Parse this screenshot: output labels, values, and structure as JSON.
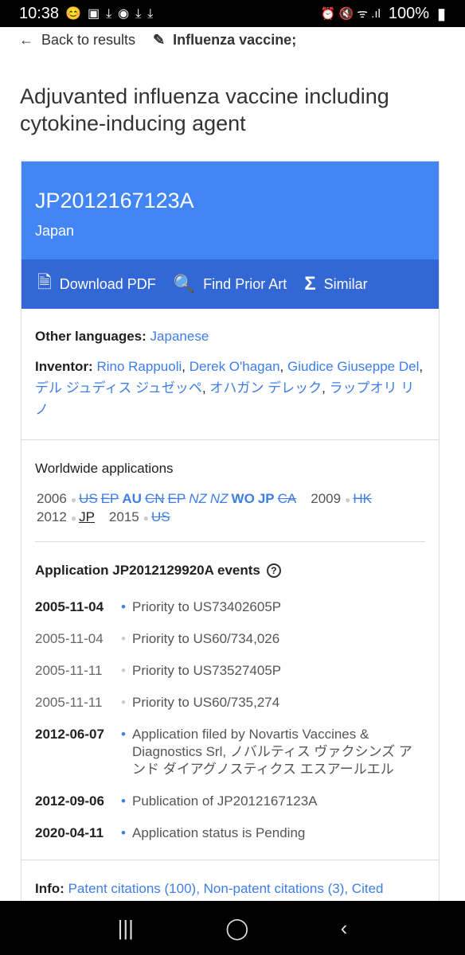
{
  "status": {
    "time": "10:38",
    "battery": "100%"
  },
  "nav": {
    "back": "Back to results",
    "query": "Influenza vaccine;"
  },
  "title": "Adjuvanted influenza vaccine including cytokine-inducing agent",
  "patent": {
    "id": "JP2012167123A",
    "country": "Japan"
  },
  "actions": {
    "download": "Download PDF",
    "prior_art": "Find Prior Art",
    "similar": "Similar"
  },
  "other_languages": {
    "label": "Other languages:",
    "value": "Japanese"
  },
  "inventor": {
    "label": "Inventor:",
    "names": [
      "Rino Rappuoli",
      "Derek O'hagan",
      "Giudice Giuseppe Del",
      "デル ジュディス ジュゼッペ",
      "オハガン デレック",
      "ラップオリ リノ"
    ]
  },
  "worldwide": {
    "title": "Worldwide applications",
    "groups": [
      {
        "year": "2006",
        "items": [
          {
            "t": "US",
            "s": "strike"
          },
          {
            "t": "EP",
            "s": "strike"
          },
          {
            "t": "AU",
            "s": "bold"
          },
          {
            "t": "CN",
            "s": "strike"
          },
          {
            "t": "EP",
            "s": "strike"
          },
          {
            "t": "NZ",
            "s": "italic"
          },
          {
            "t": "NZ",
            "s": "italic"
          },
          {
            "t": "WO",
            "s": "bold"
          },
          {
            "t": "JP",
            "s": "bold"
          },
          {
            "t": "CA",
            "s": "strike"
          }
        ]
      },
      {
        "year": "2009",
        "items": [
          {
            "t": "HK",
            "s": "strike"
          }
        ]
      },
      {
        "year": "2012",
        "items": [
          {
            "t": "JP",
            "s": "current"
          }
        ]
      },
      {
        "year": "2015",
        "items": [
          {
            "t": "US",
            "s": "strike"
          }
        ]
      }
    ]
  },
  "events": {
    "title": "Application JP2012129920A events",
    "items": [
      {
        "date": "2005-11-04",
        "text": "Priority to US73402605P",
        "active": true
      },
      {
        "date": "2005-11-04",
        "text": "Priority to US60/734,026",
        "active": false
      },
      {
        "date": "2005-11-11",
        "text": "Priority to US73527405P",
        "active": false
      },
      {
        "date": "2005-11-11",
        "text": "Priority to US60/735,274",
        "active": false
      },
      {
        "date": "2012-06-07",
        "text": "Application filed by Novartis Vaccines & Diagnostics Srl, ノバルティス ヴァクシンズ アンド ダイアグノスティクス エスアールエル",
        "active": true
      },
      {
        "date": "2012-09-06",
        "text": "Publication of JP2012167123A",
        "active": true
      },
      {
        "date": "2020-04-11",
        "text": "Application status is Pending",
        "active": true
      }
    ]
  },
  "info": {
    "label": "Info:",
    "links": "Patent citations (100), Non-patent citations (3), Cited"
  }
}
